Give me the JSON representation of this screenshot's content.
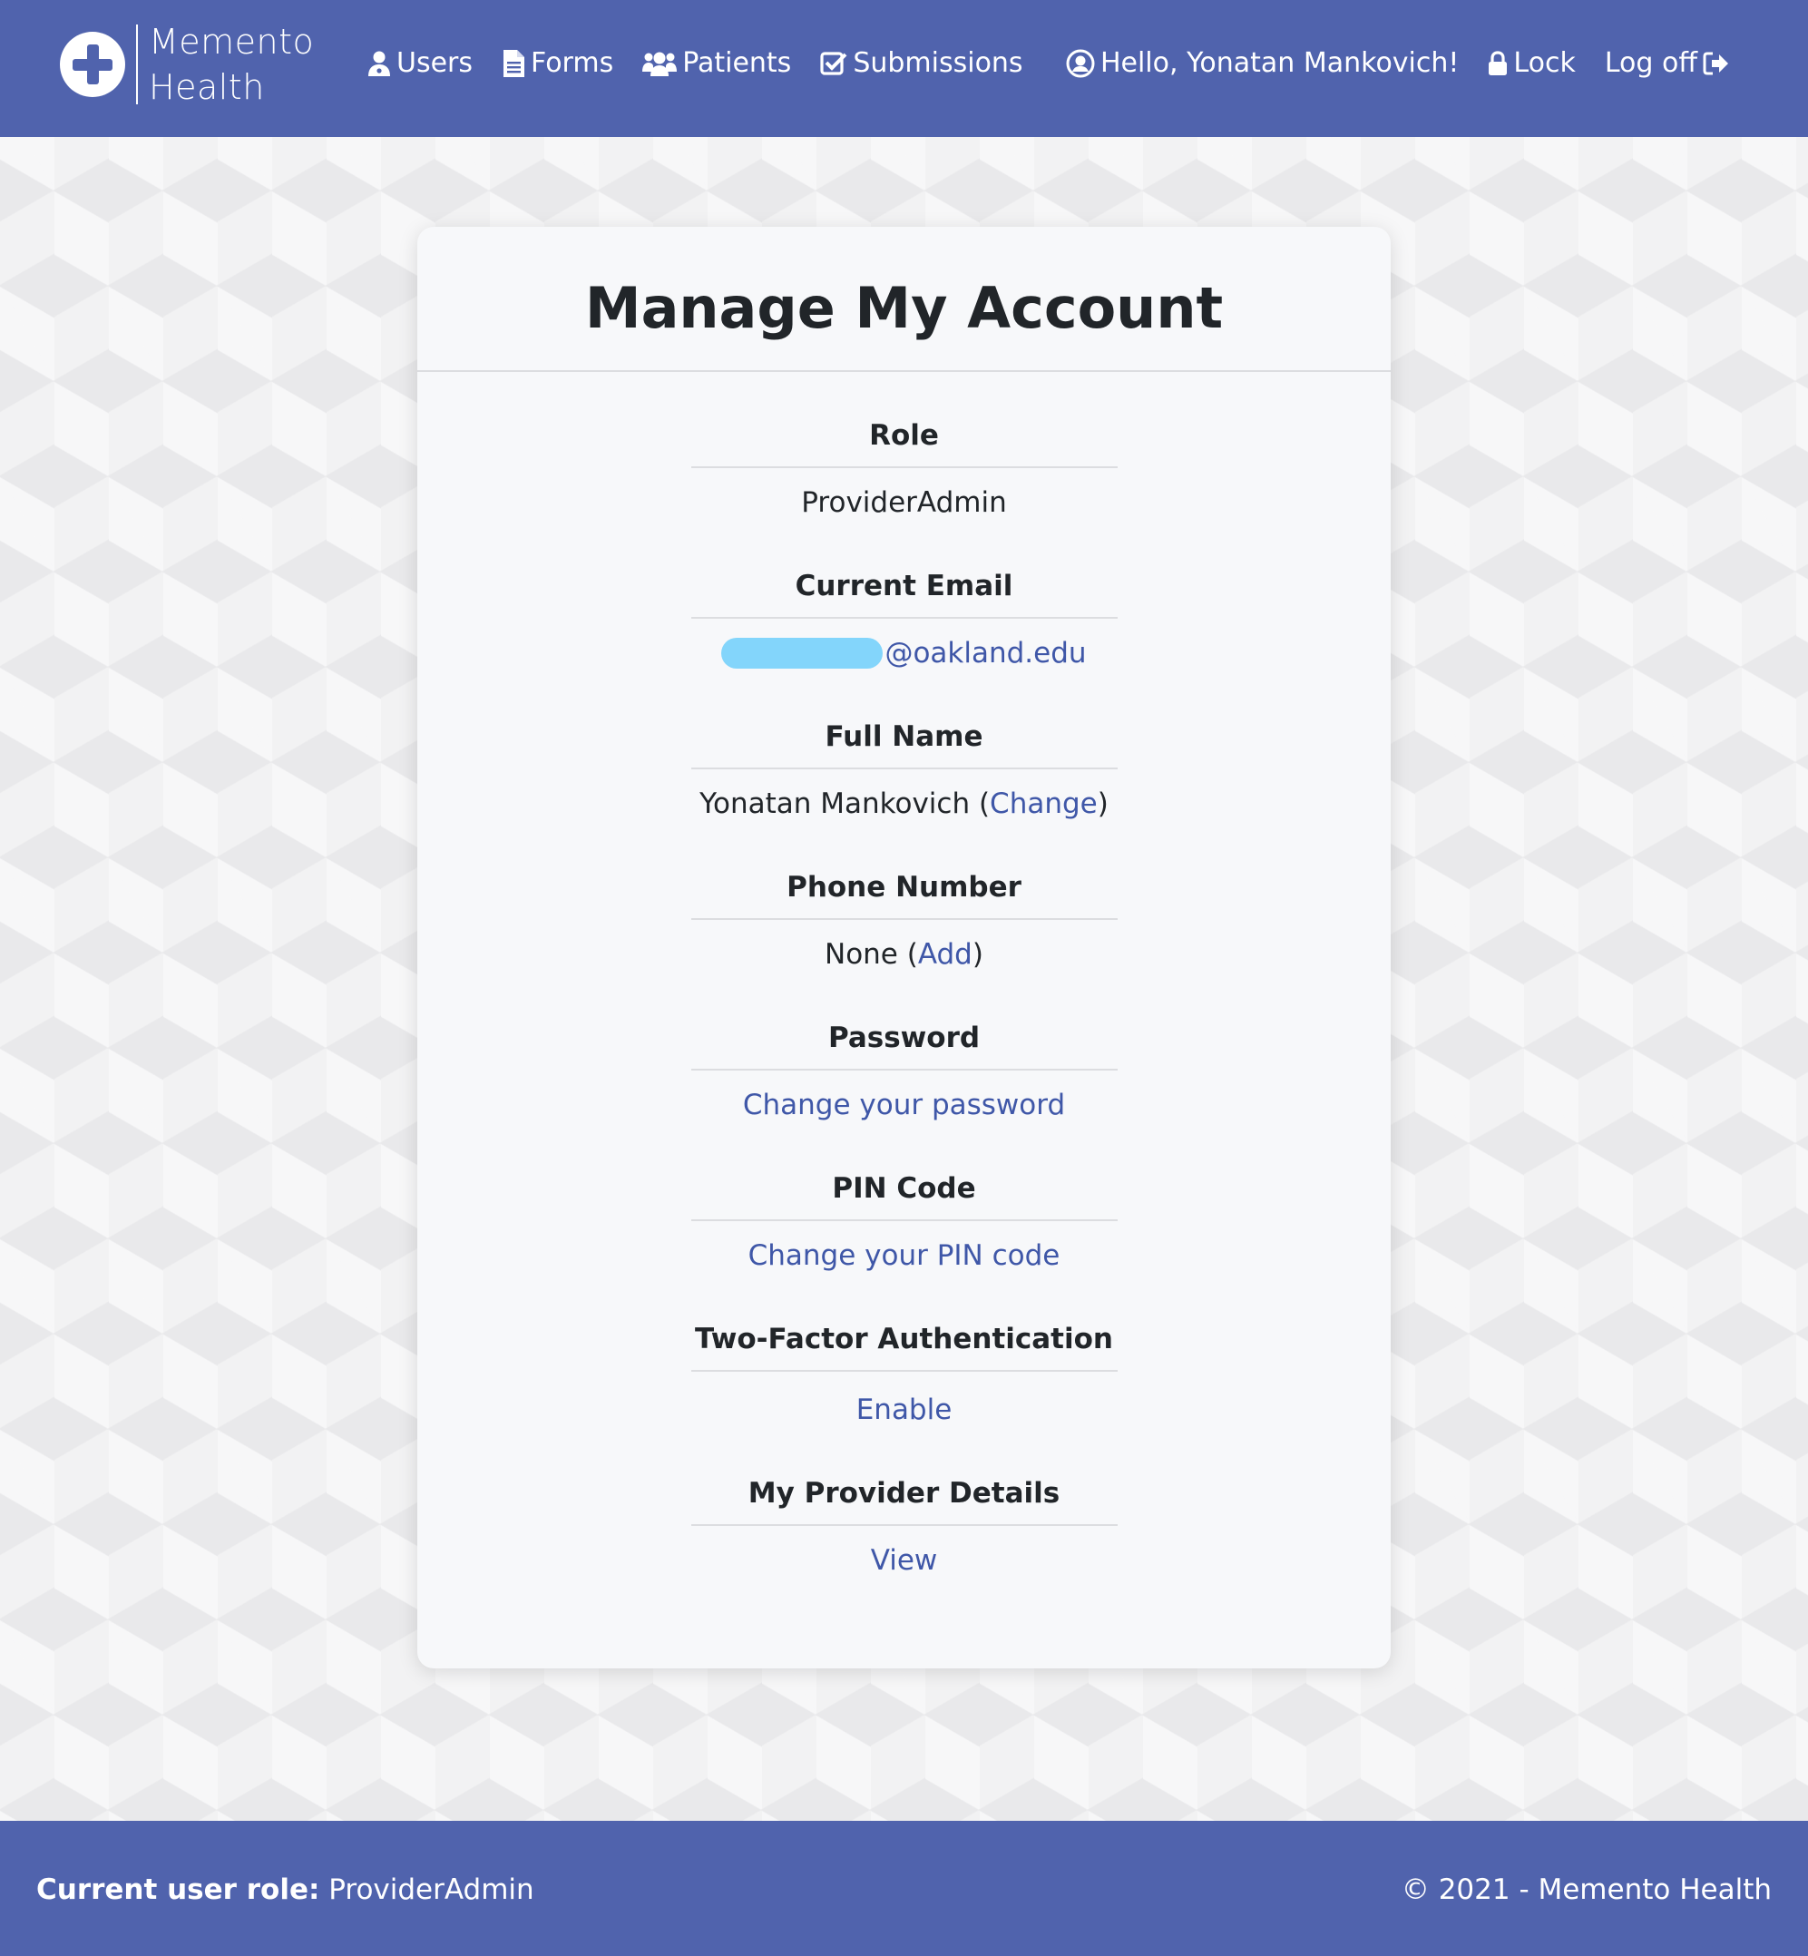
{
  "brand": {
    "line1": "Memento",
    "line2": "Health",
    "icon": "medical-cross-icon"
  },
  "nav": {
    "users": "Users",
    "forms": "Forms",
    "patients": "Patients",
    "submissions": "Submissions",
    "greeting": "Hello, Yonatan Mankovich!",
    "lock": "Lock",
    "logoff": "Log off"
  },
  "page": {
    "title": "Manage My Account"
  },
  "account": {
    "role_label": "Role",
    "role_value": "ProviderAdmin",
    "email_label": "Current Email",
    "email_domain": "@oakland.edu",
    "fullname_label": "Full Name",
    "fullname_value": "Yonatan Mankovich",
    "fullname_action": "Change",
    "phone_label": "Phone Number",
    "phone_value": "None",
    "phone_action": "Add",
    "password_label": "Password",
    "password_action": "Change your password",
    "pin_label": "PIN Code",
    "pin_action": "Change your PIN code",
    "twofactor_label": "Two-Factor Authentication",
    "twofactor_action": "Enable",
    "provider_label": "My Provider Details",
    "provider_action": "View"
  },
  "footer": {
    "role_label": "Current user role:",
    "role_value": "ProviderAdmin",
    "copyright": "© 2021 - Memento Health"
  },
  "colors": {
    "navbar": "#5063ad",
    "link": "#3f57a8",
    "redaction": "#83d5fb"
  }
}
